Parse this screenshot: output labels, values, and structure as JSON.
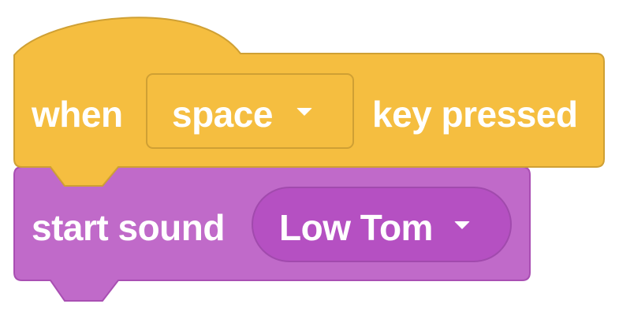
{
  "event_block": {
    "prefix_text": "when",
    "key_dropdown": {
      "selected": "space",
      "caret_icon": "caret-down-icon"
    },
    "suffix_text": "key pressed",
    "color": "#f5be40",
    "border_color": "#cfa034",
    "field_color": "#f5be40"
  },
  "sound_block": {
    "label_text": "start sound",
    "sound_dropdown": {
      "selected": "Low Tom",
      "caret_icon": "caret-down-icon"
    },
    "color": "#c06ac9",
    "border_color": "#a94fb3",
    "field_color": "#b550c2"
  }
}
